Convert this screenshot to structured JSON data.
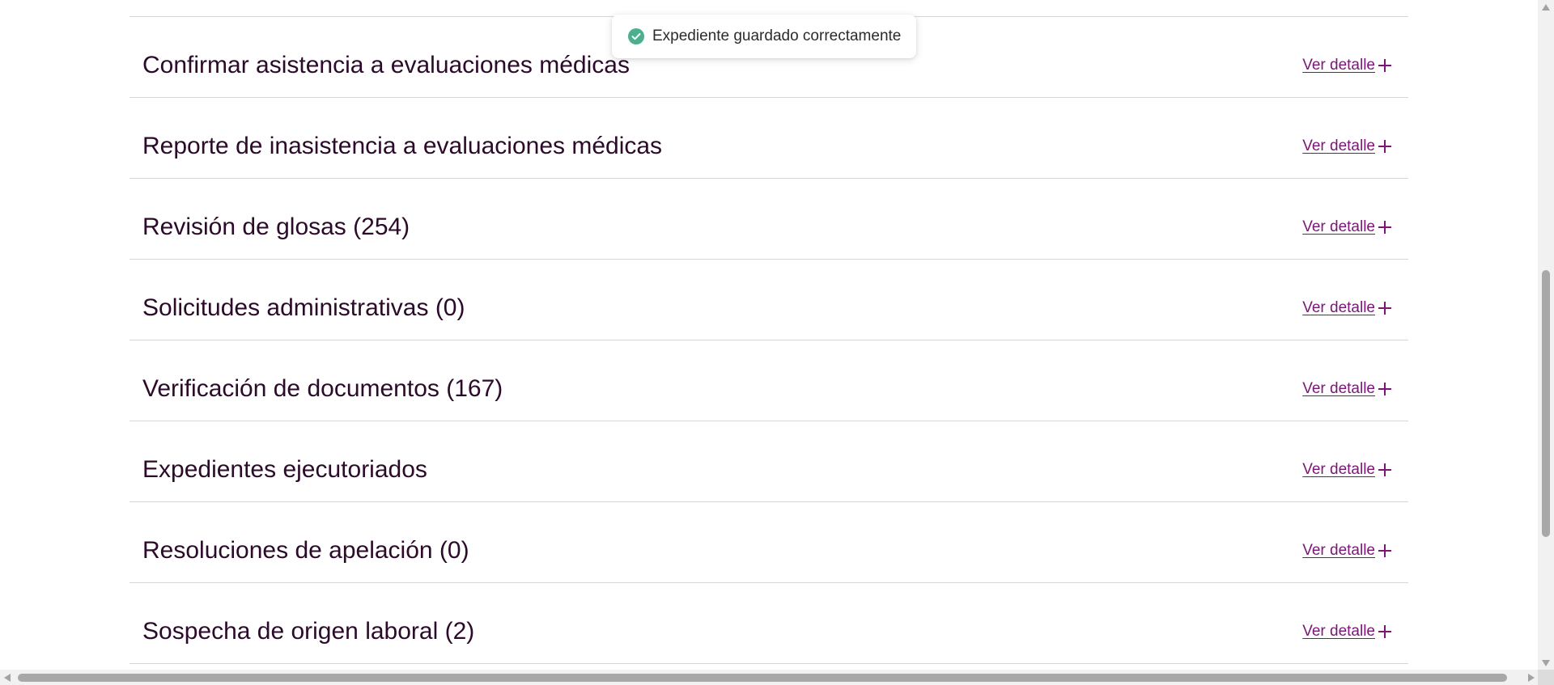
{
  "toast": {
    "message": "Expediente guardado correctamente",
    "icon": "check-circle-icon",
    "icon_color": "#4caf8e"
  },
  "accordion": {
    "link_color": "#7b1578",
    "title_color": "#2c0a2a",
    "items": [
      {
        "title": "Confirmar asistencia a evaluaciones médicas",
        "link_label": "Ver detalle ",
        "icon": "plus-icon"
      },
      {
        "title": "Reporte de inasistencia a evaluaciones médicas",
        "link_label": "Ver detalle ",
        "icon": "plus-icon"
      },
      {
        "title": "Revisión de glosas (254)",
        "link_label": "Ver detalle ",
        "icon": "plus-icon"
      },
      {
        "title": "Solicitudes administrativas (0)",
        "link_label": "Ver detalle ",
        "icon": "plus-icon"
      },
      {
        "title": "Verificación de documentos (167)",
        "link_label": "Ver detalle ",
        "icon": "plus-icon"
      },
      {
        "title": "Expedientes ejecutoriados",
        "link_label": "Ver detalle ",
        "icon": "plus-icon"
      },
      {
        "title": "Resoluciones de apelación (0)",
        "link_label": "Ver detalle ",
        "icon": "plus-icon"
      },
      {
        "title": "Sospecha de origen laboral (2)",
        "link_label": "Ver detalle ",
        "icon": "plus-icon"
      }
    ]
  },
  "scrollbars": {
    "vertical_icons": [
      "triangle-up-icon",
      "triangle-down-icon"
    ],
    "horizontal_icons": [
      "triangle-left-icon",
      "triangle-right-icon"
    ]
  }
}
